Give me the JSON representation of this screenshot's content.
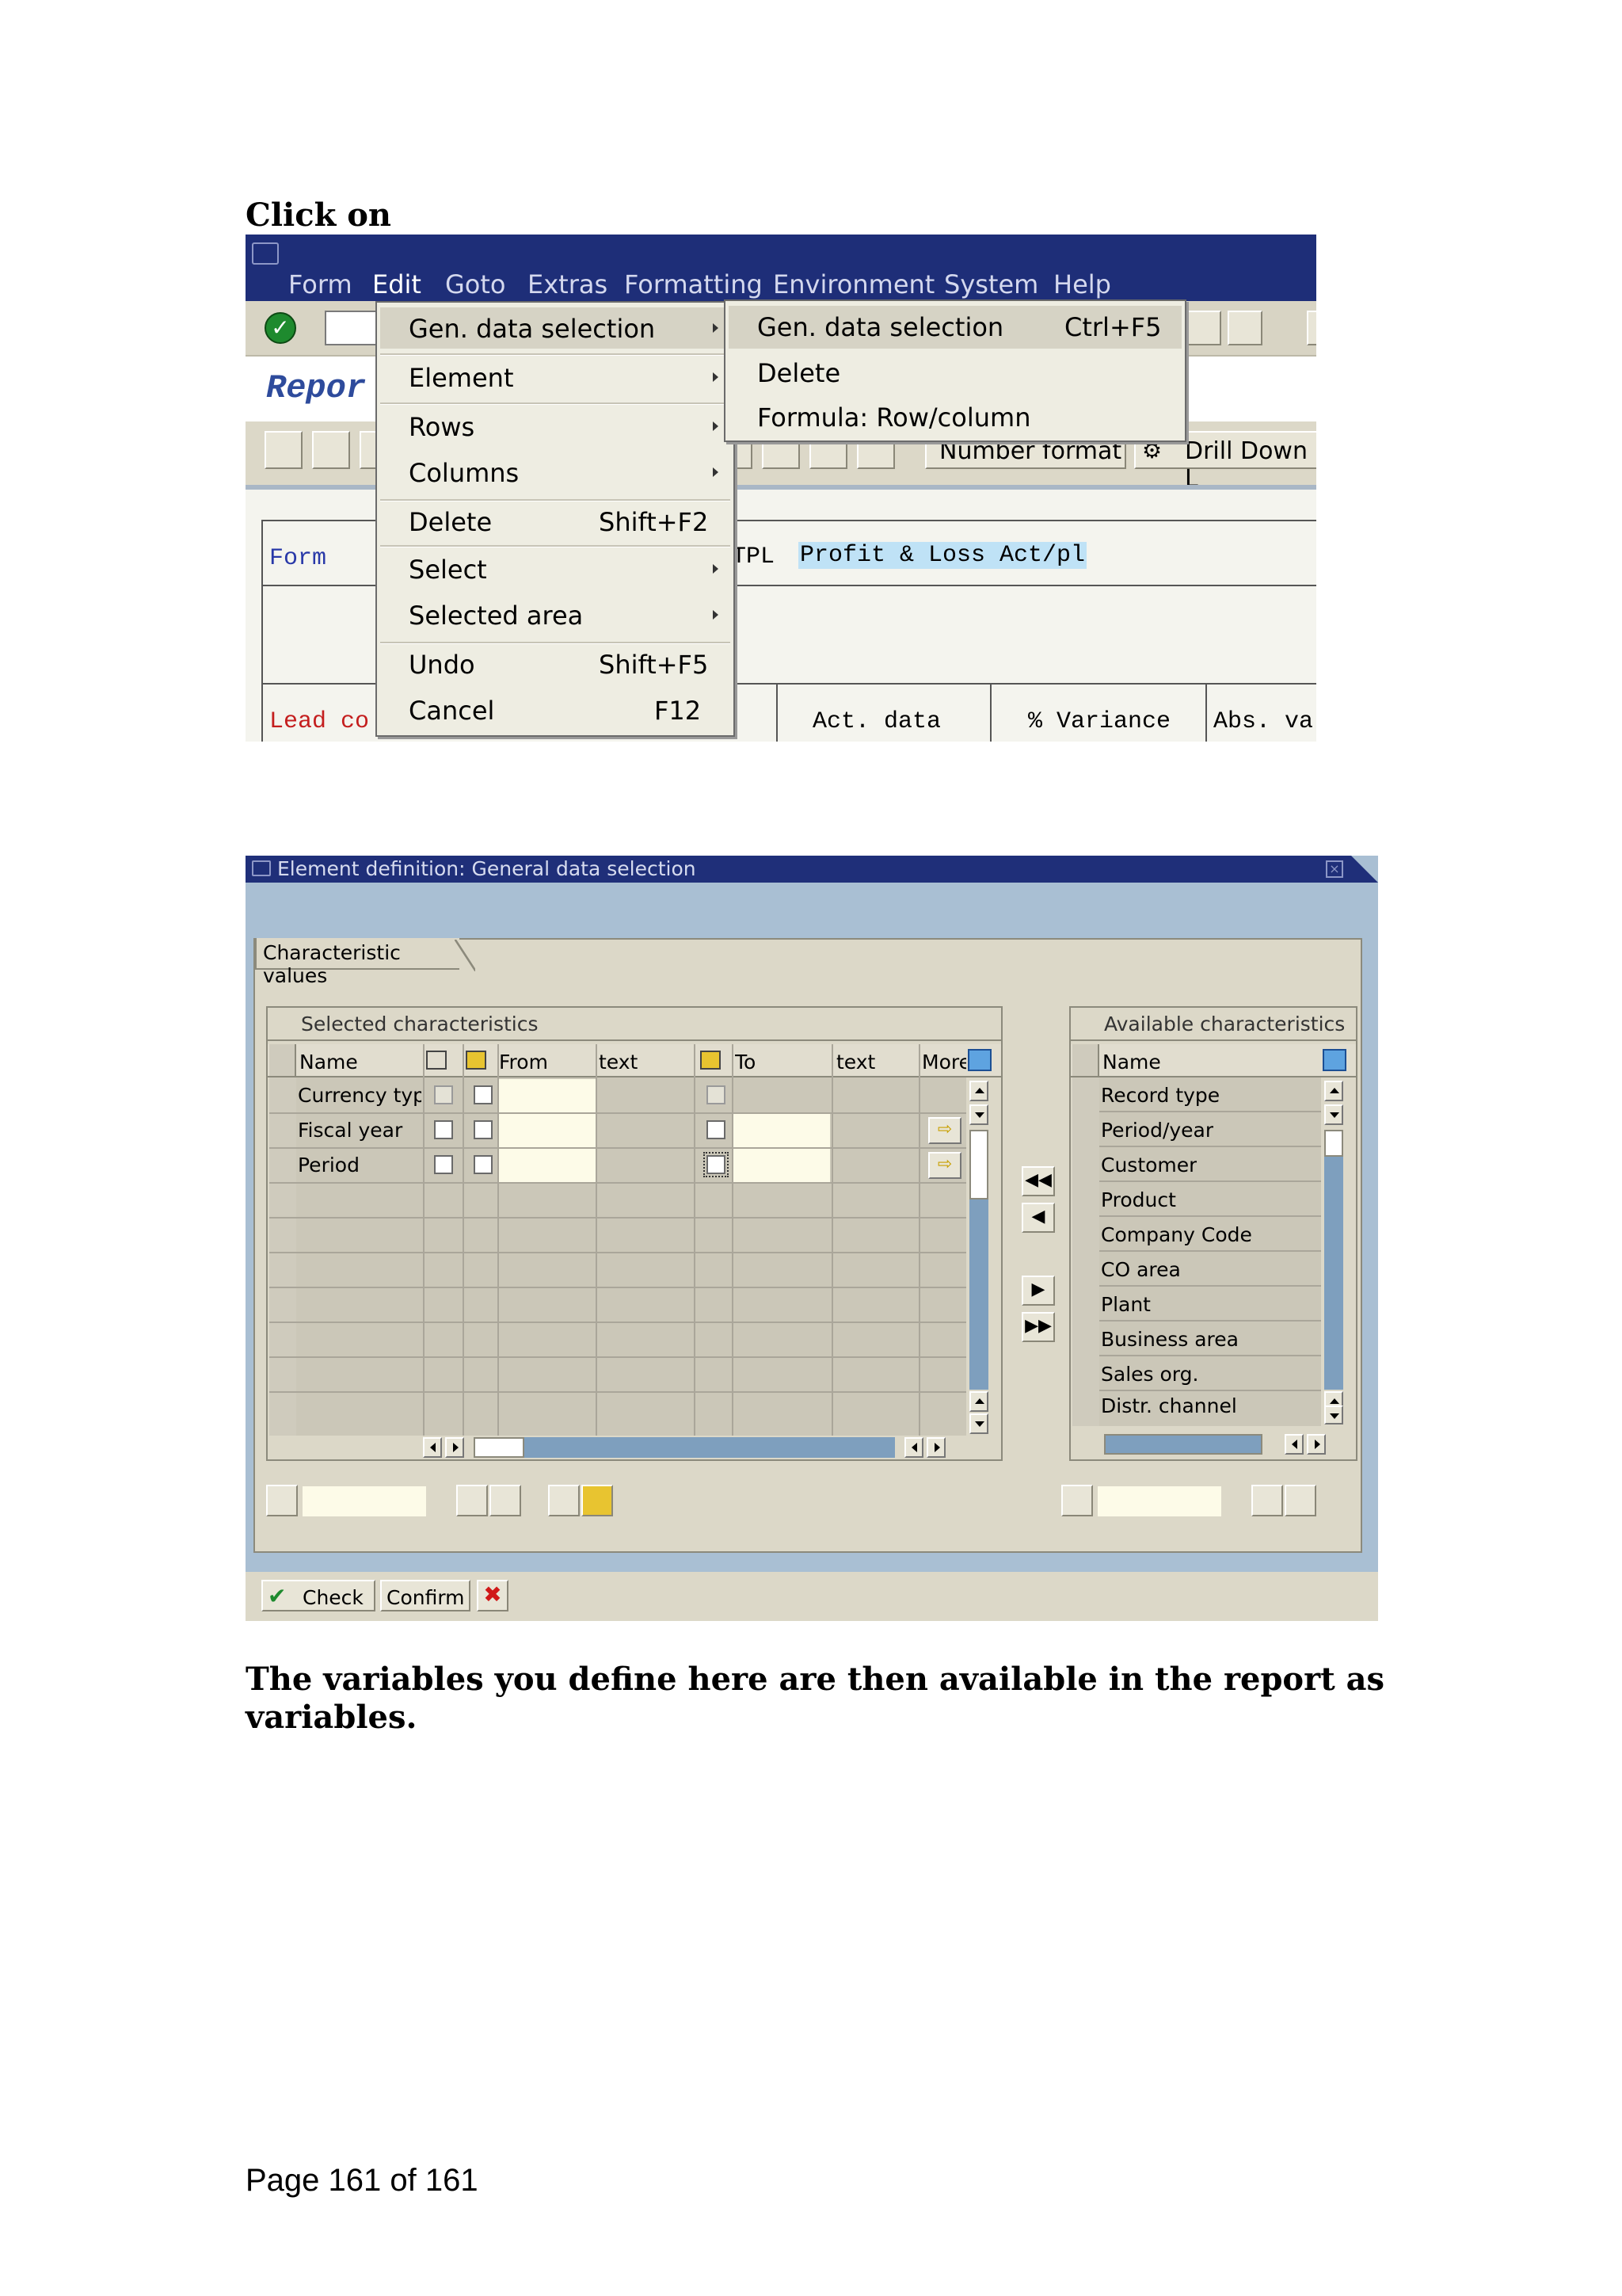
{
  "heading_top": "Click on",
  "screenshot1": {
    "menu_bar": [
      "Form",
      "Edit",
      "Goto",
      "Extras",
      "Formatting",
      "Environment",
      "System",
      "Help"
    ],
    "title_partial": "Repor",
    "toolbar_buttons": {
      "number_format": "Number format",
      "drill_down": "Drill Down L"
    },
    "form_label": "Form",
    "form_code_partial": "TPL",
    "form_description": "Profit & Loss Act/pl",
    "lead_col_partial": "Lead co",
    "column_headers": [
      "Act. data",
      "% Variance",
      "Abs. va"
    ],
    "edit_menu": [
      {
        "label": "Gen. data selection",
        "submenu": true
      },
      {
        "label": "Element",
        "submenu": true
      },
      {
        "label": "Rows",
        "submenu": true
      },
      {
        "label": "Columns",
        "submenu": true
      },
      {
        "label": "Delete",
        "shortcut": "Shift+F2"
      },
      {
        "label": "Select",
        "submenu": true
      },
      {
        "label": "Selected area",
        "submenu": true
      },
      {
        "label": "Undo",
        "shortcut": "Shift+F5"
      },
      {
        "label": "Cancel",
        "shortcut": "F12"
      }
    ],
    "submenu": [
      {
        "label": "Gen. data selection",
        "shortcut": "Ctrl+F5"
      },
      {
        "label": "Delete"
      },
      {
        "label": "Formula: Row/column"
      }
    ]
  },
  "screenshot2": {
    "window_title": "Element definition: General data selection",
    "tab_label": "Characteristic values",
    "selected": {
      "title": "Selected characteristics",
      "headers": [
        "Name",
        "From",
        "text",
        "To",
        "text",
        "More"
      ],
      "rows": [
        "Currency type",
        "Fiscal year",
        "Period"
      ]
    },
    "available": {
      "title": "Available characteristics",
      "header": "Name",
      "rows": [
        "Record type",
        "Period/year",
        "Customer",
        "Product",
        "Company Code",
        "CO area",
        "Plant",
        "Business area",
        "Sales org.",
        "Distr. channel"
      ]
    },
    "buttons": {
      "check": "Check",
      "confirm": "Confirm"
    }
  },
  "closing_text": "The variables you define here are then available in the report as variables.",
  "footer": "Page 161 of 161"
}
